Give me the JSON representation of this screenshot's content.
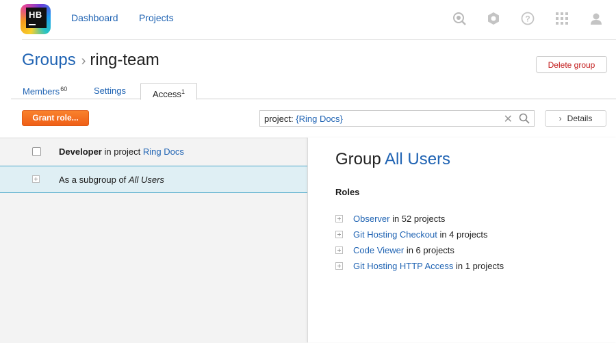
{
  "header": {
    "logo_text": "HB",
    "nav": [
      {
        "label": "Dashboard"
      },
      {
        "label": "Projects"
      }
    ],
    "icons": [
      "search-icon",
      "hub-settings-icon",
      "help-icon",
      "services-grid-icon",
      "user-avatar-icon"
    ]
  },
  "breadcrumb": {
    "root": "Groups",
    "separator": "›",
    "current": "ring-team"
  },
  "actions": {
    "delete_group": "Delete group",
    "grant_role": "Grant role...",
    "details": "Details"
  },
  "tabs": [
    {
      "label": "Members",
      "count": "60"
    },
    {
      "label": "Settings",
      "count": ""
    },
    {
      "label": "Access",
      "count": "1",
      "active": true
    }
  ],
  "search": {
    "prefix": "project: ",
    "value": "{Ring Docs}"
  },
  "list": [
    {
      "role": "Developer",
      "middle": " in project ",
      "target": "Ring Docs"
    },
    {
      "prefix": "As a subgroup of ",
      "target": "All Users"
    }
  ],
  "details": {
    "title_prefix": "Group ",
    "group_name": "All Users",
    "roles_heading": "Roles",
    "roles": [
      {
        "name": "Observer",
        "suffix": " in 52 projects"
      },
      {
        "name": "Git Hosting Checkout",
        "suffix": " in 4 projects"
      },
      {
        "name": "Code Viewer",
        "suffix": " in 6 projects"
      },
      {
        "name": "Git Hosting HTTP Access",
        "suffix": " in 1 projects"
      }
    ]
  },
  "colors": {
    "link": "#1f63b3",
    "primary_button": "#f26b1d",
    "danger_text": "#c21a1a",
    "selected_row": "#dfeff4",
    "selected_border": "#4ca7c9"
  }
}
